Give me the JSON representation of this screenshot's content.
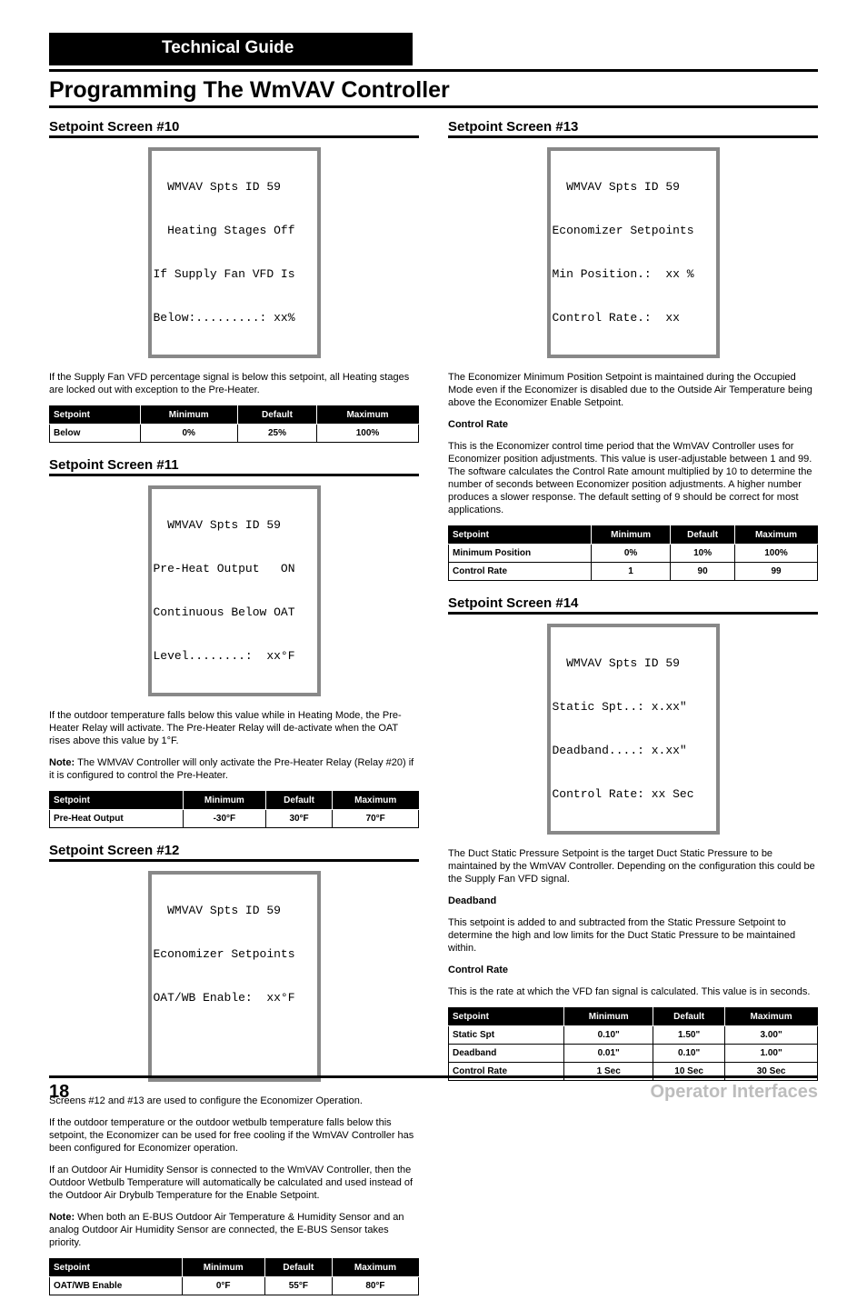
{
  "header": {
    "guide": "Technical Guide"
  },
  "title": "Programming The WmVAV Controller",
  "footer": {
    "page": "18",
    "label": "Operator Interfaces"
  },
  "left": {
    "s10": {
      "heading": "Setpoint Screen #10",
      "lcd": [
        "  WMVAV Spts ID 59",
        "  Heating Stages Off",
        "If Supply Fan VFD Is",
        "Below:.........: xx%"
      ],
      "para": "If the Supply Fan VFD percentage signal is below this setpoint, all Heating stages are locked out with exception to the Pre-Heater.",
      "table": {
        "headers": [
          "Setpoint",
          "Minimum",
          "Default",
          "Maximum"
        ],
        "rows": [
          [
            "Below",
            "0%",
            "25%",
            "100%"
          ]
        ]
      }
    },
    "s11": {
      "heading": "Setpoint Screen #11",
      "lcd": [
        "  WMVAV Spts ID 59",
        "Pre-Heat Output   ON",
        "Continuous Below OAT",
        "Level........:  xx°F"
      ],
      "para": "If the outdoor temperature falls below this value while in Heating Mode, the Pre-Heater Relay will activate. The Pre-Heater Relay will de-activate when the OAT rises above this value by 1°F.",
      "note": "The WMVAV Controller will only activate the Pre-Heater Relay (Relay #20) if it is configured to control the Pre-Heater.",
      "table": {
        "headers": [
          "Setpoint",
          "Minimum",
          "Default",
          "Maximum"
        ],
        "rows": [
          [
            "Pre-Heat Output",
            "-30°F",
            "30°F",
            "70°F"
          ]
        ]
      }
    },
    "s12": {
      "heading": "Setpoint Screen #12",
      "lcd": [
        "  WMVAV Spts ID 59",
        "Economizer Setpoints",
        "OAT/WB Enable:  xx°F",
        ""
      ],
      "para1": "Screens #12 and #13 are used to configure the Economizer Operation.",
      "para2": "If the outdoor temperature or the outdoor wetbulb temperature falls below this setpoint, the Economizer can be used for free cooling if the WmVAV Controller has been configured for Economizer operation.",
      "para3": "If an Outdoor Air Humidity Sensor is connected to the WmVAV Controller, then the Outdoor Wetbulb Temperature will automatically be calculated and used instead of the Outdoor Air Drybulb Temperature for the Enable Setpoint.",
      "note": "When both an E-BUS Outdoor Air Temperature & Humidity Sensor and an analog Outdoor Air Humidity Sensor are connected, the E-BUS Sensor takes priority.",
      "table": {
        "headers": [
          "Setpoint",
          "Minimum",
          "Default",
          "Maximum"
        ],
        "rows": [
          [
            "OAT/WB Enable",
            "0°F",
            "55°F",
            "80°F"
          ]
        ]
      }
    }
  },
  "right": {
    "s13": {
      "heading": "Setpoint Screen #13",
      "lcd": [
        "  WMVAV Spts ID 59",
        "Economizer Setpoints",
        "Min Position.:  xx %",
        "Control Rate.:  xx"
      ],
      "min_para": "The Economizer Minimum Position Setpoint is maintained during the Occupied Mode even if the Economizer is disabled due to the Outside Air Temperature being above the Economizer Enable Setpoint.",
      "rate_head": "Control Rate",
      "rate_para": "This is the Economizer control time period that the WmVAV Controller uses for Economizer position adjustments. This value is user-adjustable between 1 and 99. The software calculates the Control Rate amount multiplied by 10 to determine the number of seconds between Economizer position adjustments. A higher number produces a slower response. The default setting of 9 should be correct for most applications.",
      "table": {
        "headers": [
          "Setpoint",
          "Minimum",
          "Default",
          "Maximum"
        ],
        "rows": [
          [
            "Minimum Position",
            "0%",
            "10%",
            "100%"
          ],
          [
            "Control Rate",
            "1",
            "90",
            "99"
          ]
        ]
      }
    },
    "s14": {
      "heading": "Setpoint Screen #14",
      "lcd": [
        "  WMVAV Spts ID 59",
        "Static Spt..: x.xx\"",
        "Deadband....: x.xx\"",
        "Control Rate: xx Sec"
      ],
      "static_para": "The Duct Static Pressure Setpoint is the target Duct Static Pressure to be maintained by the WmVAV Controller. Depending on the configuration this could be the Supply Fan VFD signal.",
      "dead_head": "Deadband",
      "dead_para": "This setpoint is added to and subtracted from the Static Pressure Setpoint to determine the high and low limits for the Duct Static Pressure to be maintained within.",
      "ctrl_head": "Control Rate",
      "ctrl_para": "This is the rate at which the VFD fan signal is calculated. This value is in seconds.",
      "table": {
        "headers": [
          "Setpoint",
          "Minimum",
          "Default",
          "Maximum"
        ],
        "rows": [
          [
            "Static Spt",
            "0.10\"",
            "1.50\"",
            "3.00\""
          ],
          [
            "Deadband",
            "0.01\"",
            "0.10\"",
            "1.00\""
          ],
          [
            "Control Rate",
            "1 Sec",
            "10 Sec",
            "30 Sec"
          ]
        ]
      }
    }
  }
}
